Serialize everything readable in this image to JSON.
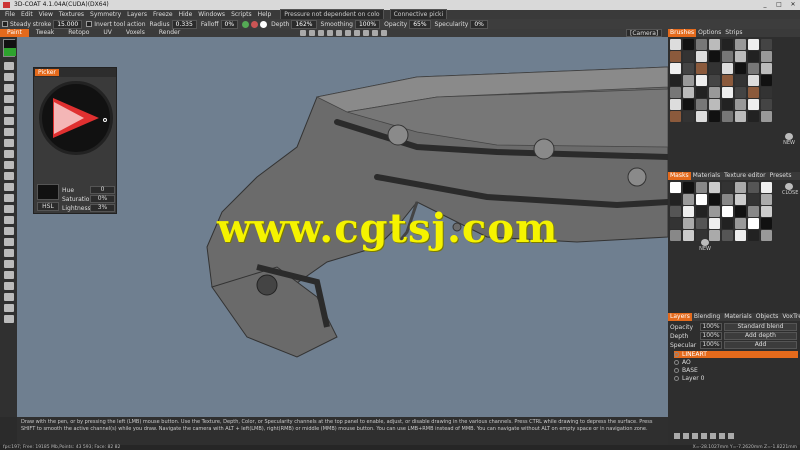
{
  "title": "3D-COAT 4.1.04A(CUDA)(DX64)",
  "window_buttons": [
    "_",
    "□",
    "✕"
  ],
  "menu": [
    "File",
    "Edit",
    "View",
    "Textures",
    "Symmetry",
    "Layers",
    "Freeze",
    "Hide",
    "Windows",
    "Scripts",
    "Help"
  ],
  "menu_tip": "Pressure not dependent on colo",
  "menu_tip2": "Connective picki",
  "tool_options": {
    "steady_label": "Steady stroke",
    "steady_value": "15.000",
    "invert_label": "Invert tool action",
    "radius_label": "Radius",
    "radius_value": "0.335",
    "falloff_label": "Falloff",
    "falloff_value": "0%",
    "depth_label": "Depth",
    "depth_value": "162%",
    "smoothing_label": "Smoothing",
    "smoothing_value": "100%",
    "opacity_label": "Opacity",
    "opacity_value": "65%",
    "specularity_label": "Specularity",
    "specularity_value": "0%"
  },
  "room_tabs": [
    "Paint",
    "Tweak",
    "Retopo",
    "UV",
    "Voxels",
    "Render"
  ],
  "camera": "[Camera]",
  "watermark": "www.cgtsj.com",
  "picker": {
    "title": "Picker",
    "mode": "HSL",
    "hue_label": "Hue",
    "hue": "0",
    "sat_label": "Saturation",
    "sat": "0%",
    "light_label": "Lightness",
    "light": "3%"
  },
  "brushes": {
    "tabs": [
      "Brushes",
      "Options",
      "Strips"
    ],
    "new_label": "NEW"
  },
  "masks": {
    "tabs": [
      "Masks",
      "Materials",
      "Texture editor",
      "Presets"
    ],
    "new_label": "NEW",
    "close_label": "CLOSE"
  },
  "layers": {
    "tabs": [
      "Layers",
      "Blending",
      "Materials",
      "Objects",
      "VoxTree"
    ],
    "opacity_label": "Opacity",
    "opacity": "100%",
    "blend": "Standard blend",
    "depth_label": "Depth",
    "depth": "100%",
    "depth_mode": "Add depth",
    "spec_label": "Specular",
    "spec": "100%",
    "spec_mode": "Add",
    "items": [
      {
        "name": "LINEART",
        "active": true
      },
      {
        "name": "AO",
        "active": false
      },
      {
        "name": "BASE",
        "active": false
      },
      {
        "name": "Layer 0",
        "active": false
      }
    ]
  },
  "hint": "Draw with the pen, or by pressing the left (LMB) mouse button. Use the Texture, Depth, Color, or Specularity channels at the top panel to enable, adjust, or disable drawing in the various channels. Press CTRL while drawing to depress the surface. Press SHIFT to smooth the active channel(s) while you draw. Navigate the camera with ALT + left(LMB), right(RMB) or middle (MMB) mouse button. You can use LMB+RMB instead of MMB. You can navigate without ALT on empty space or in navigation zone.",
  "status_left": "fps:197;  Free: 19185 Mb,Points: 43 593; Face: 82 82",
  "status_right": "X=-28.1027mm  Y=-7.2620mm  Z=-1.8221mm",
  "colors": {
    "accent": "#e46a1c",
    "viewport": "#6f7f90",
    "watermark": "#f5f300"
  }
}
